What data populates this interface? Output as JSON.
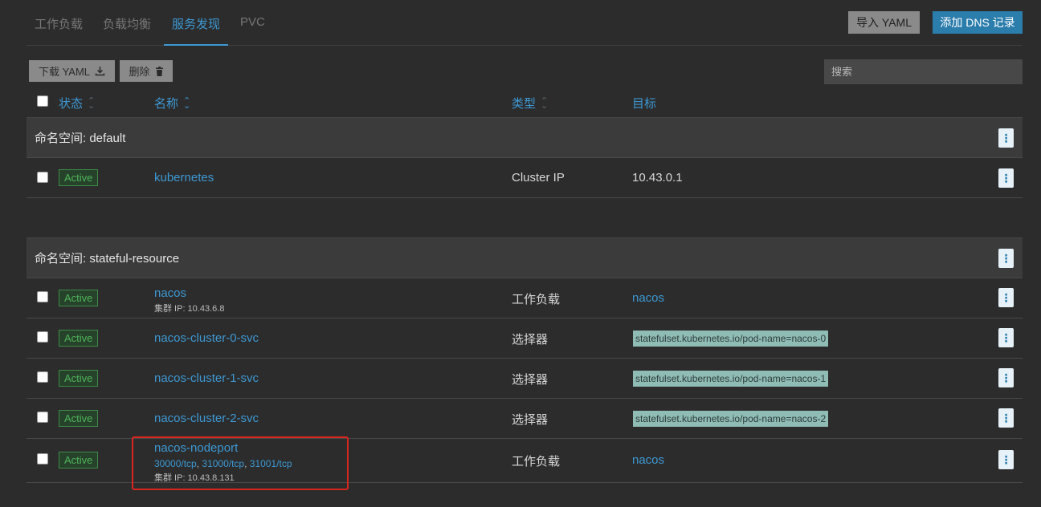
{
  "tabs": [
    "工作负载",
    "负载均衡",
    "服务发现",
    "PVC"
  ],
  "actions": {
    "import_yaml": "导入 YAML",
    "add_dns": "添加 DNS 记录"
  },
  "toolbar": {
    "download_yaml": "下载 YAML",
    "delete": "删除",
    "search_placeholder": "搜索"
  },
  "columns": {
    "state": "状态",
    "name": "名称",
    "type": "类型",
    "target": "目标"
  },
  "namespaces": [
    {
      "label": "命名空间: default"
    },
    {
      "label": "命名空间: stateful-resource"
    }
  ],
  "rows": [
    {
      "state": "Active",
      "name": "kubernetes",
      "type": "Cluster IP",
      "target": "10.43.0.1"
    },
    {
      "state": "Active",
      "name": "nacos",
      "sub": "集群 IP: 10.43.6.8",
      "type": "工作负载",
      "target": "nacos"
    },
    {
      "state": "Active",
      "name": "nacos-cluster-0-svc",
      "type": "选择器",
      "target": "statefulset.kubernetes.io/pod-name=nacos-0"
    },
    {
      "state": "Active",
      "name": "nacos-cluster-1-svc",
      "type": "选择器",
      "target": "statefulset.kubernetes.io/pod-name=nacos-1"
    },
    {
      "state": "Active",
      "name": "nacos-cluster-2-svc",
      "type": "选择器",
      "target": "statefulset.kubernetes.io/pod-name=nacos-2"
    },
    {
      "state": "Active",
      "name": "nacos-nodeport",
      "ports": [
        "30000/tcp",
        "31000/tcp",
        "31001/tcp"
      ],
      "port_sep": ", ",
      "sub": "集群 IP: 10.43.8.131",
      "type": "工作负载",
      "target": "nacos"
    }
  ],
  "colors": {
    "accent": "#3d98d3",
    "active_green": "#4fb35b",
    "highlight_red": "#d8261f",
    "primary_button": "#2b7dac"
  }
}
